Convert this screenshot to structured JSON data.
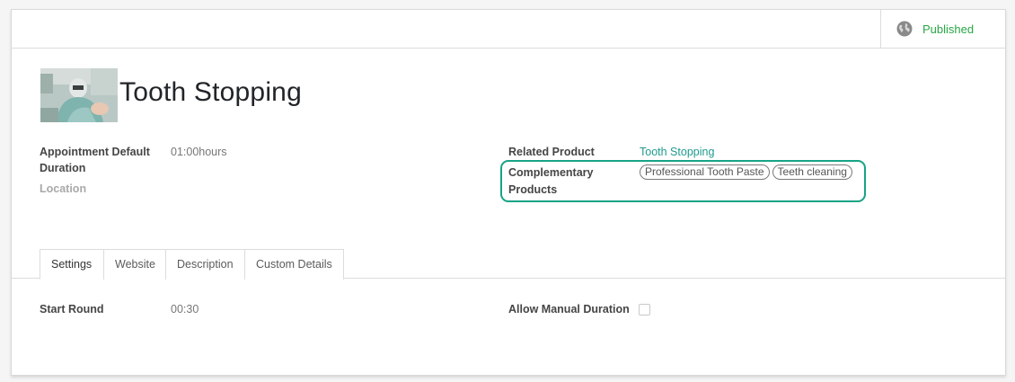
{
  "header": {
    "publish_label": "Published",
    "publish_icon": "globe-icon",
    "status_color": "#28a745"
  },
  "record": {
    "title": "Tooth Stopping",
    "image_icon": "dentist-photo"
  },
  "fields": {
    "appointment_duration_label_line1": "Appointment Default",
    "appointment_duration_label_line2": "Duration",
    "appointment_duration_value": "01:00hours",
    "location_label": "Location",
    "related_product_label": "Related Product",
    "related_product_value": "Tooth Stopping",
    "complementary_label_line1": "Complementary",
    "complementary_label_line2": "Products",
    "complementary_tags": [
      "Professional Tooth Paste",
      "Teeth cleaning"
    ]
  },
  "tabs": [
    "Settings",
    "Website",
    "Description",
    "Custom Details"
  ],
  "settings": {
    "start_round_label": "Start Round",
    "start_round_value": "00:30",
    "allow_manual_label": "Allow Manual Duration",
    "allow_manual_checked": false
  },
  "colors": {
    "link": "#1f9a8f",
    "highlight": "#18a385"
  }
}
